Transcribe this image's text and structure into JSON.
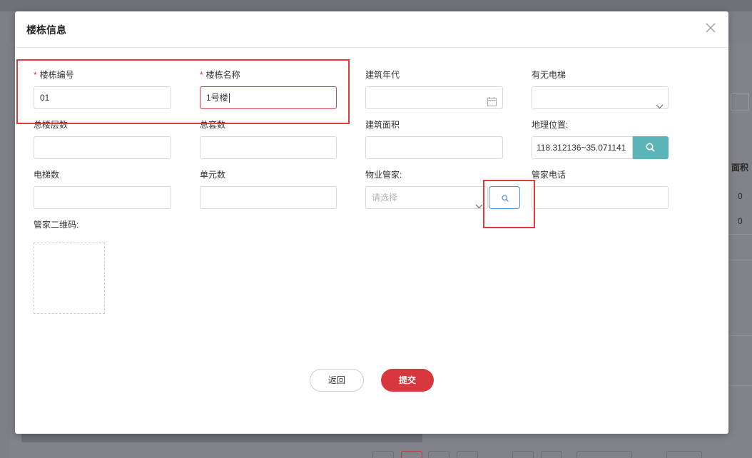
{
  "background_page": {
    "column_header": "面积",
    "row_values": [
      "0",
      "0"
    ]
  },
  "dialog": {
    "title": "楼栋信息",
    "close_icon": "close-icon"
  },
  "form": {
    "building_no": {
      "label": "楼栋编号",
      "required": true,
      "value": "01"
    },
    "building_name": {
      "label": "楼栋名称",
      "required": true,
      "value": "1号楼"
    },
    "build_year": {
      "label": "建筑年代",
      "value": "",
      "icon": "calendar-icon"
    },
    "has_elevator": {
      "label": "有无电梯",
      "value": "",
      "icon": "chevron-down-icon"
    },
    "total_floors": {
      "label": "总楼层数",
      "value": ""
    },
    "total_households": {
      "label": "总套数",
      "value": ""
    },
    "build_area": {
      "label": "建筑面积",
      "value": ""
    },
    "location": {
      "label": "地理位置:",
      "value": "118.312136~35.071141",
      "icon": "search-icon"
    },
    "elevator_count": {
      "label": "电梯数",
      "value": ""
    },
    "unit_count": {
      "label": "单元数",
      "value": ""
    },
    "property_manager": {
      "label": "物业管家:",
      "placeholder": "请选择",
      "icon": "search-icon"
    },
    "manager_phone": {
      "label": "管家电话",
      "value": ""
    },
    "manager_qrcode": {
      "label": "管家二维码:"
    }
  },
  "actions": {
    "back_label": "返回",
    "submit_label": "提交"
  },
  "colors": {
    "accent_red": "#d7373d",
    "teal": "#5bb4b8",
    "annotation": "#e03a3a",
    "focus_border": "#c9453f",
    "link_blue": "#4a90e2"
  }
}
